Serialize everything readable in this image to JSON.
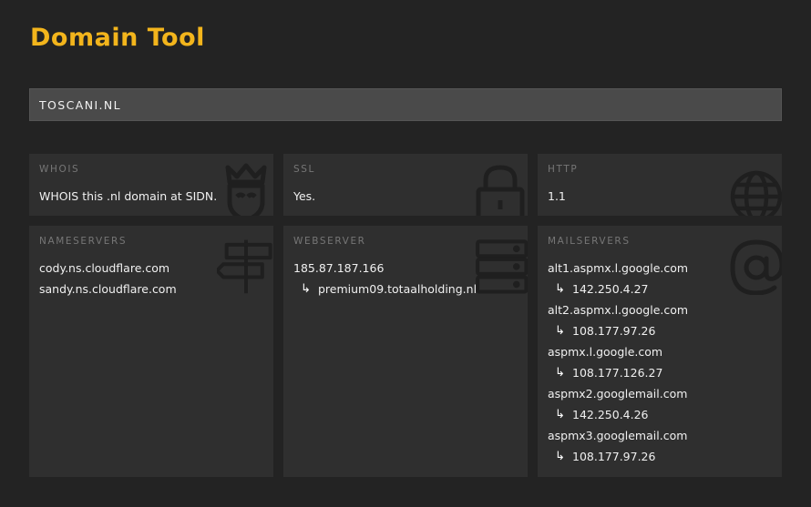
{
  "app": {
    "title": "Domain Tool"
  },
  "search": {
    "value": "TOSCANI.NL"
  },
  "cards": {
    "whois": {
      "label": "WHOIS",
      "text": "WHOIS this .nl domain at SIDN.",
      "icon": "shield-crown-icon"
    },
    "ssl": {
      "label": "SSL",
      "text": "Yes.",
      "icon": "lock-icon"
    },
    "http": {
      "label": "HTTP",
      "text": "1.1",
      "icon": "globe-icon"
    },
    "nameservers": {
      "label": "NAMESERVERS",
      "icon": "signpost-icon",
      "items": [
        "cody.ns.cloudflare.com",
        "sandy.ns.cloudflare.com"
      ]
    },
    "webserver": {
      "label": "WEBSERVER",
      "icon": "server-icon",
      "ip": "185.87.187.166",
      "host": "premium09.totaalholding.nl"
    },
    "mailservers": {
      "label": "MAILSERVERS",
      "icon": "at-sign-icon",
      "items": [
        {
          "host": "alt1.aspmx.l.google.com",
          "ip": "142.250.4.27"
        },
        {
          "host": "alt2.aspmx.l.google.com",
          "ip": "108.177.97.26"
        },
        {
          "host": "aspmx.l.google.com",
          "ip": "108.177.126.27"
        },
        {
          "host": "aspmx2.googlemail.com",
          "ip": "142.250.4.26"
        },
        {
          "host": "aspmx3.googlemail.com",
          "ip": "108.177.97.26"
        }
      ]
    }
  },
  "colors": {
    "accent": "#f3b51c",
    "background": "#232323",
    "card": "#2f2f2f",
    "input": "#4a4a4a",
    "icon": "#1f1f1f"
  },
  "glyphs": {
    "reply_arrow": "↳"
  }
}
